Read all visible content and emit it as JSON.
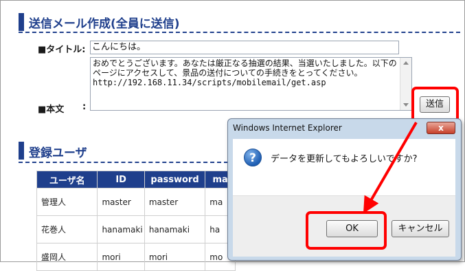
{
  "form": {
    "section_title": "送信メール作成(全員に送信)",
    "title_label": "■タイトル:",
    "title_value": "こんにちは。",
    "body_label": "■本文",
    "body_colon": ":",
    "body_value": "おめでとうございます。あなたは厳正なる抽選の結果、当選いたしました。以下のページにアクセスして、景品の送付についての手続きをとってください。\nhttp://192.168.11.34/scripts/mobilemail/get.asp",
    "send_button": "送信"
  },
  "users": {
    "section_title": "登録ユーザ",
    "columns": [
      "ユーザ名",
      "ID",
      "password",
      "ma"
    ],
    "rows": [
      [
        "管理人",
        "master",
        "master",
        "ma"
      ],
      [
        "花巻人",
        "hanamaki",
        "hanamaki",
        "ha"
      ],
      [
        "盛岡人",
        "mori",
        "mori",
        "mo"
      ]
    ]
  },
  "dialog": {
    "title": "Windows Internet Explorer",
    "close_label": "x",
    "message": "データを更新してもよろしいですか?",
    "ok_label": "OK",
    "cancel_label": "キャンセル"
  },
  "colors": {
    "accent": "#1f3f8c",
    "highlight": "#ff0000"
  }
}
